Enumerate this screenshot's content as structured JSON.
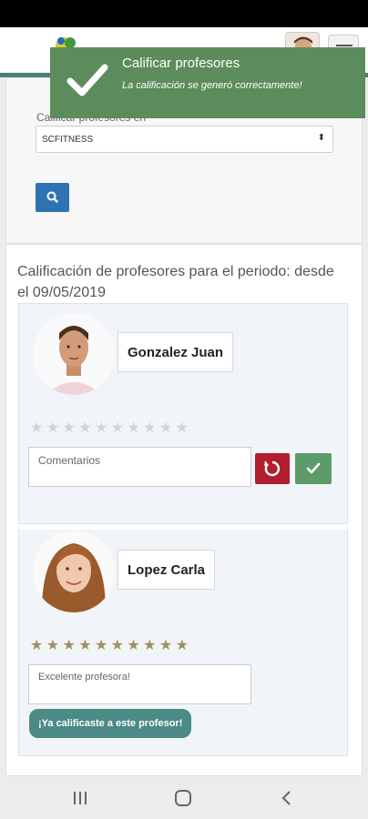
{
  "toast": {
    "title": "Calificar profesores",
    "message": "La calificación se generó correctamente!"
  },
  "filter": {
    "label": "Calificar profesores en",
    "selected_value": "SCFITNESS"
  },
  "period_title": "Calificación de profesores para el periodo: desde el 09/05/2019",
  "teachers": [
    {
      "name": "Gonzalez Juan",
      "comment_placeholder": "Comentarios",
      "rating": 0,
      "max_rating": 10
    },
    {
      "name": "Lopez Carla",
      "comment_value": "Excelente profesora!",
      "rating": 10,
      "max_rating": 10,
      "badge": "¡Ya calificaste a este profesor!"
    }
  ],
  "colors": {
    "toast": "#5c8c5c",
    "primary": "#2f73b5",
    "danger": "#b01e30",
    "success": "#5c9b6a",
    "accent": "#4c8a85",
    "star_empty": "#d3d3d3",
    "star_filled": "#a38f5e"
  },
  "icons": {
    "toast": "check-icon",
    "search": "search-icon",
    "reset": "undo-icon",
    "confirm": "check-icon",
    "nav_recent": "recent-apps-icon",
    "nav_home": "home-icon",
    "nav_back": "back-icon"
  }
}
